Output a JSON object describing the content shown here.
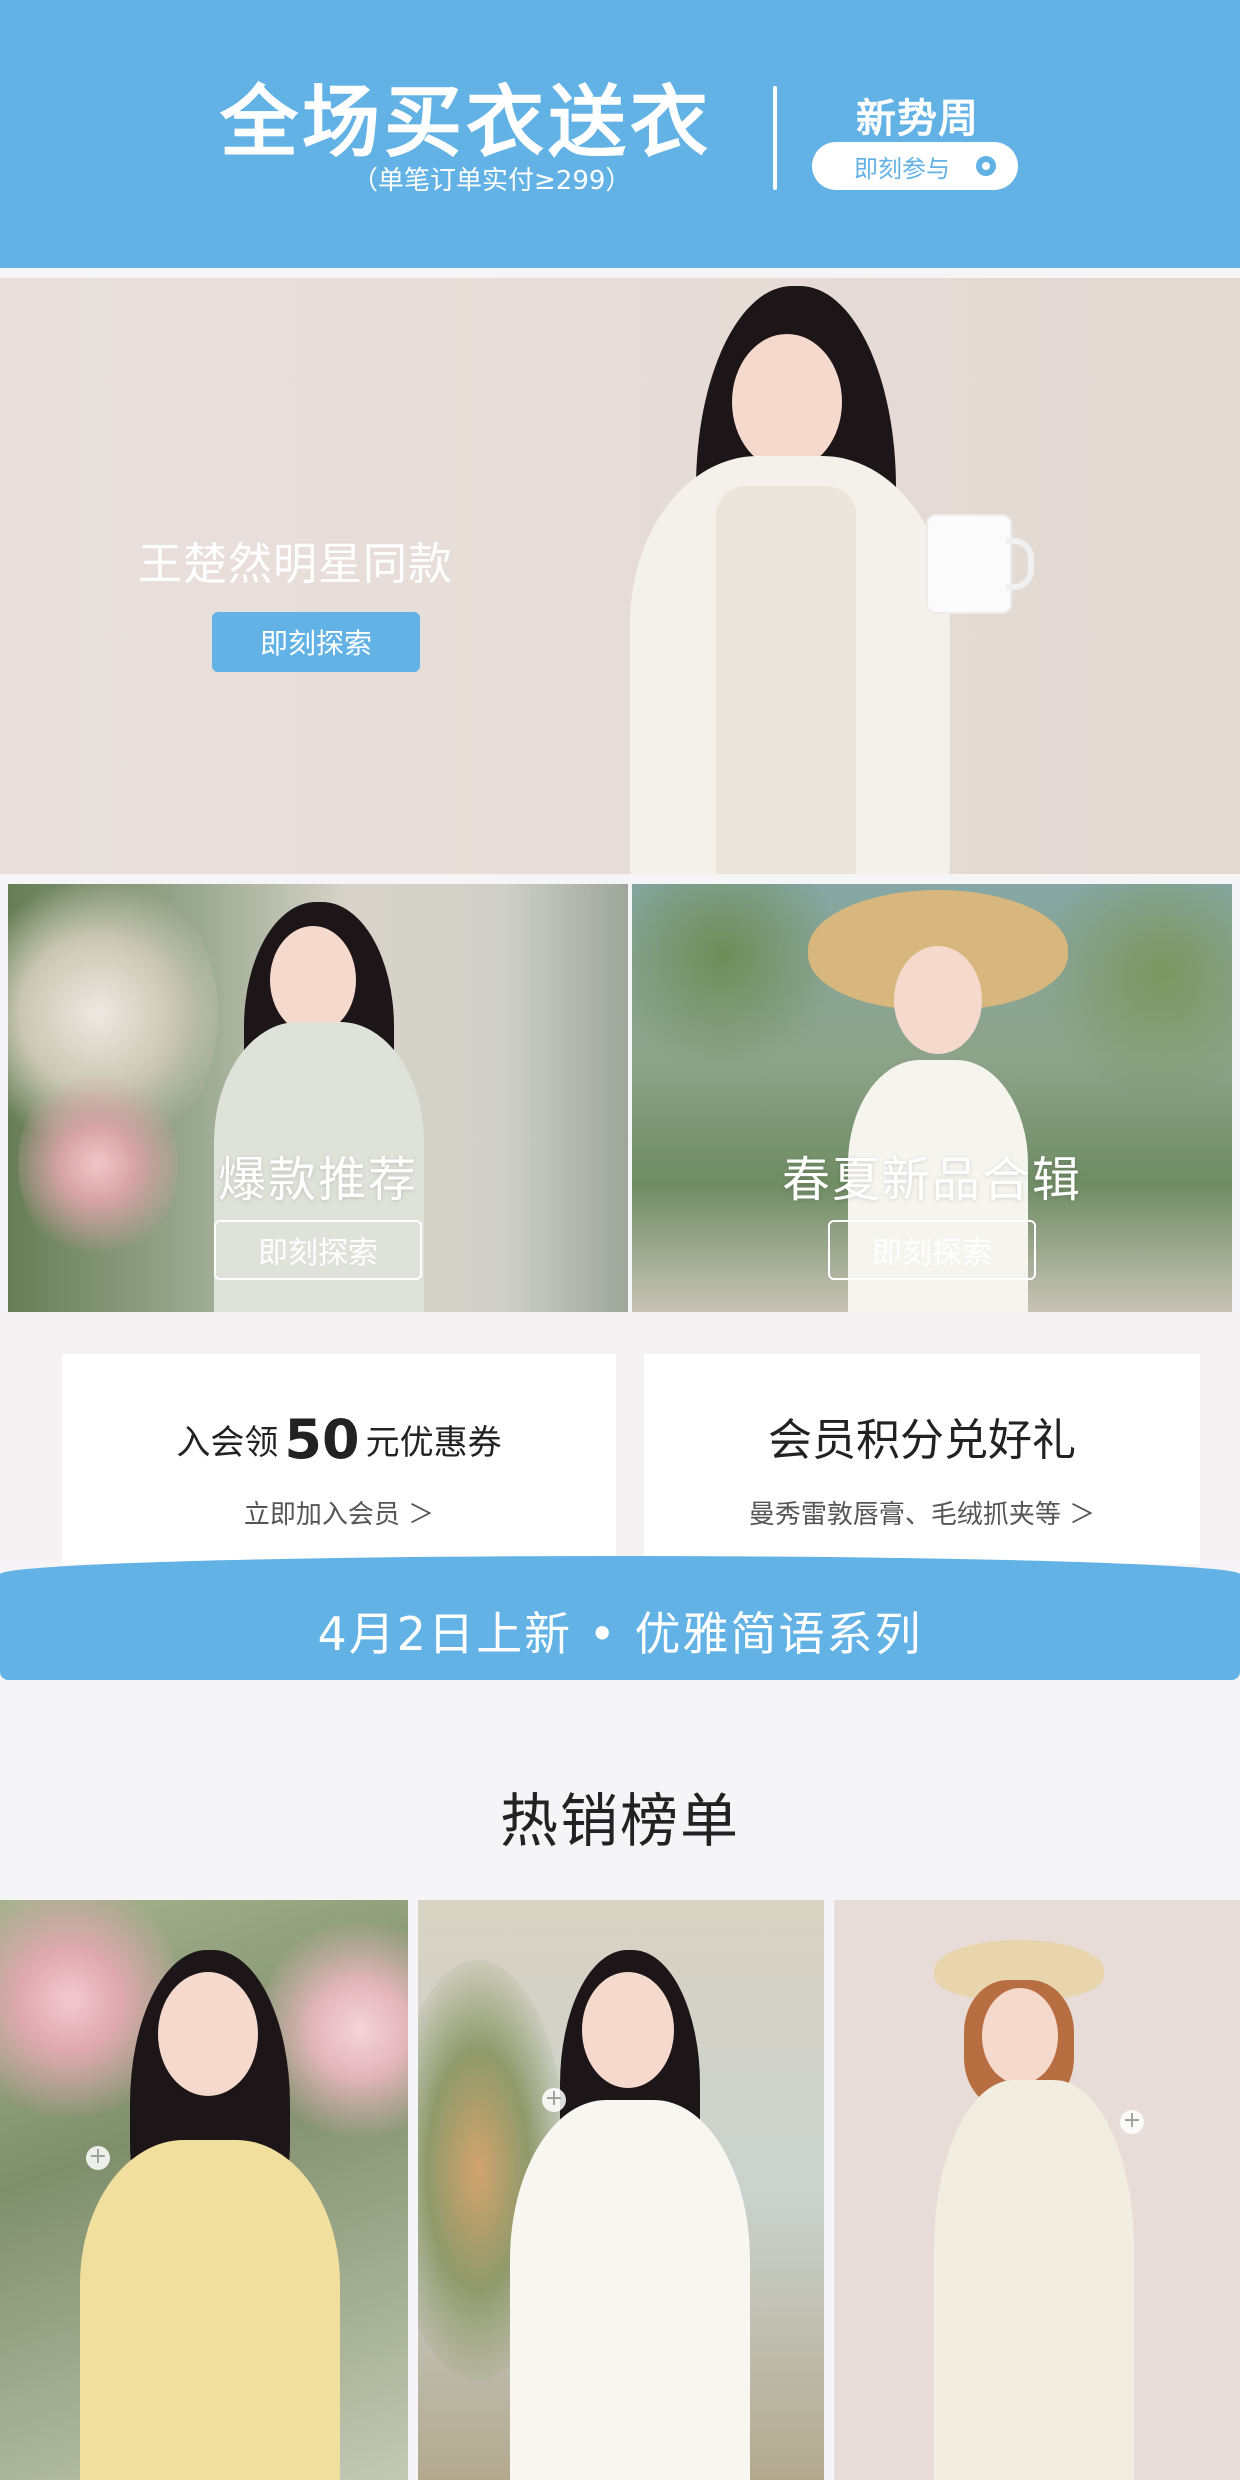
{
  "top_banner": {
    "headline": "全场买衣送衣",
    "subline": "（单笔订单实付≥299）",
    "brand": "新势周",
    "join_label": "即刻参与"
  },
  "hero": {
    "title": "王楚然明星同款",
    "button_label": "即刻探索"
  },
  "tiles": [
    {
      "title": "爆款推荐",
      "button_label": "即刻探索"
    },
    {
      "title": "春夏新品合辑",
      "button_label": "即刻探索"
    }
  ],
  "member_cards": [
    {
      "title_prefix": "入会领",
      "title_number": "50",
      "title_suffix": "元优惠券",
      "sub": "立即加入会员 ＞"
    },
    {
      "title": "会员积分兑好礼",
      "sub": "曼秀雷敦唇膏、毛绒抓夹等 ＞"
    }
  ],
  "ribbon": {
    "text": "4月2日上新 • 优雅简语系列"
  },
  "hot_list": {
    "title": "热销榜单",
    "add_symbol": "+"
  },
  "colors": {
    "accent": "#62b2e6"
  }
}
